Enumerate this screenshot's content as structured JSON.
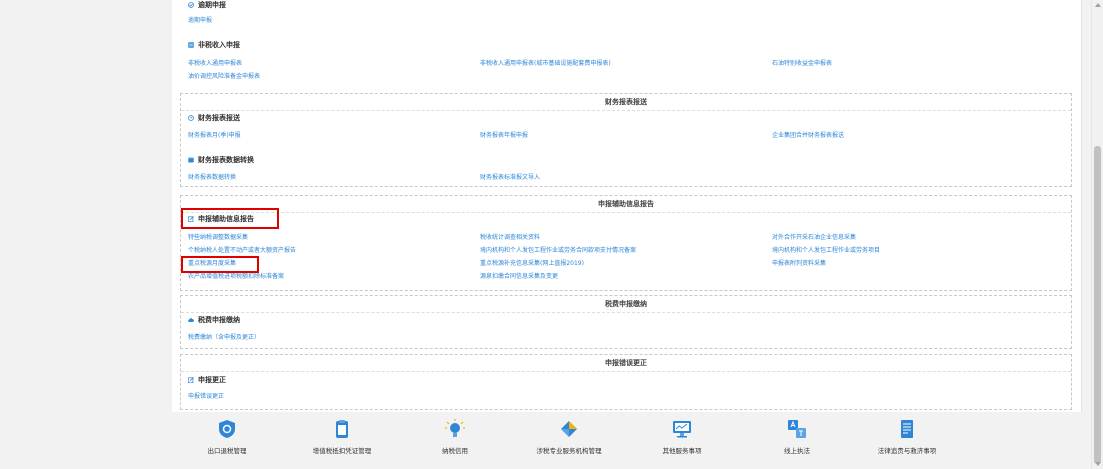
{
  "sections": {
    "overdue": {
      "title": "逾期申报",
      "links": [
        "逾期申报"
      ]
    },
    "non_tax": {
      "title": "非税收入申报",
      "links": [
        "非税收入通用申报表",
        "非税收入通用申报表(城市基础设施配套费申报表)",
        "石油特别收益金申报表",
        "油价调控风险准备金申报表"
      ]
    },
    "financial_box": {
      "title": "财务报表报送",
      "sub1": {
        "title": "财务报表报送",
        "links": [
          "财务报表月(季)申报",
          "财务报表年报申报",
          "企业集团合并财务报表报送"
        ]
      },
      "sub2": {
        "title": "财务报表数据转换",
        "links": [
          "财务报表数据转换",
          "财务报表标准报文导入"
        ]
      }
    },
    "aux_box": {
      "title": "申报辅助信息报告",
      "sub": {
        "title": "申报辅助信息报告",
        "links": [
          "特些纳税调整数据采集",
          "税收统计调查相关资料",
          "对外合作开采石油企业信息采集",
          "个税纳税人处置不动产或者大额资产报告",
          "境内机构和个人发包工程作业或劳务合同款项支付情况备案",
          "境内机构和个人发包工程作业或劳务项目",
          "重点税源月度采集",
          "重点税源补充信息采集(网上直报2019)",
          "申报表附列资料采集",
          "农产品增值税进项税额扣除标准备案",
          "源泉扣缴合同信息采集及变更"
        ]
      }
    },
    "fee_box": {
      "title": "税费申报缴纳",
      "sub": {
        "title": "税费申报缴纳",
        "links": [
          "税费缴纳（含申报及更正）"
        ]
      }
    },
    "correction_box": {
      "title": "申报错误更正",
      "sub": {
        "title": "申报更正",
        "links": [
          "申报错误更正"
        ]
      }
    }
  },
  "bottom_nav": [
    {
      "label": "出口退税管理",
      "icon": "shield-icon"
    },
    {
      "label": "增值税抵扣凭证管理",
      "icon": "tablet-icon"
    },
    {
      "label": "纳税信用",
      "icon": "lightbulb-icon"
    },
    {
      "label": "涉税专业服务机构管理",
      "icon": "diamond-icon"
    },
    {
      "label": "其他服务事项",
      "icon": "monitor-icon"
    },
    {
      "label": "线上执法",
      "icon": "translate-icon"
    },
    {
      "label": "法律追责与救济事项",
      "icon": "document-icon"
    }
  ],
  "colors": {
    "link": "#2f86d6",
    "highlight": "#e00000",
    "icon_blue": "#2f86d6"
  }
}
